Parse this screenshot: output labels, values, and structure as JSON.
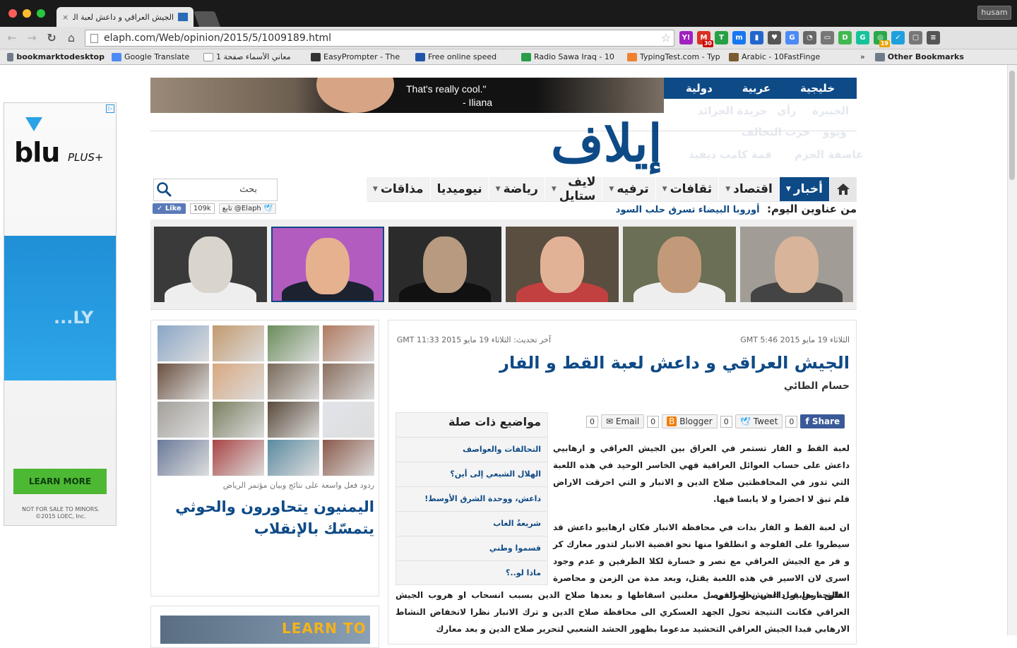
{
  "browser": {
    "tab_title": "الجيش العراقي و داعش لعبة القط و",
    "user_button": "husam",
    "url": "elaph.com/Web/opinion/2015/5/1009189.html",
    "extensions": [
      {
        "icon": "yahoo-icon",
        "label": "Y!",
        "color": "#a020c0"
      },
      {
        "icon": "gmail-icon",
        "label": "M",
        "color": "#d93025"
      },
      {
        "icon": "trello-icon",
        "label": "T",
        "color": "#26a046"
      },
      {
        "icon": "messenger-icon",
        "label": "m",
        "color": "#1877f2"
      },
      {
        "icon": "stats-icon",
        "label": "▮",
        "color": "#2266cc"
      },
      {
        "icon": "pocket-icon",
        "label": "♥",
        "color": "#555555"
      },
      {
        "icon": "translate-icon",
        "label": "G",
        "color": "#4c8bf5"
      },
      {
        "icon": "clock-icon",
        "label": "◔",
        "color": "#666666"
      },
      {
        "icon": "cast-icon",
        "label": "▭",
        "color": "#777777"
      },
      {
        "icon": "pushbullet-icon",
        "label": "D",
        "color": "#3fb950"
      },
      {
        "icon": "grammarly-icon",
        "label": "G",
        "color": "#15c39a"
      },
      {
        "icon": "timer-icon",
        "label": "◎",
        "color": "#2aa84a"
      },
      {
        "icon": "check-icon",
        "label": "✓",
        "color": "#1ea0dc"
      },
      {
        "icon": "screen-icon",
        "label": "▢",
        "color": "#777777"
      },
      {
        "icon": "menu-icon",
        "label": "≡",
        "color": "#555555"
      }
    ],
    "gmail_badge": "30",
    "timer_badge": "19",
    "bookmarks": [
      {
        "label": "bookmarktodesktop",
        "icon": "folder-icon"
      },
      {
        "label": "Google Translate",
        "icon": "translate-icon"
      },
      {
        "label": "1 معاني الأسماء صفحة",
        "icon": "page-icon"
      },
      {
        "label": "EasyPrompter - The",
        "icon": "ep-icon"
      },
      {
        "label": "Free online speed",
        "icon": "speed-icon"
      },
      {
        "label": "Radio Sawa Iraq - 10",
        "icon": "radio-icon"
      },
      {
        "label": "TypingTest.com - Typ",
        "icon": "typing-icon"
      },
      {
        "label": "Arabic - 10FastFinge",
        "icon": "fingers-icon"
      }
    ],
    "bookmarks_overflow": "»",
    "other_bookmarks": "Other Bookmarks"
  },
  "ad_left": {
    "brand": "blu",
    "brand_suffix": "PLUS+",
    "blur_text": "...LY",
    "cta": "LEARN MORE",
    "fine1": "NOT FOR SALE TO MINORS.",
    "fine2": "©2015 LOEC, Inc.",
    "adchoice": "▷"
  },
  "banner": {
    "quote_line1": "That's really cool.\"",
    "quote_line2": "- Iliana"
  },
  "site": {
    "logo": "إيلاف",
    "top_categories": [
      "خليجية",
      "عربية",
      "دولية"
    ],
    "faint_row1": [
      "الخبيرة",
      "رأي",
      "جريدة الجرائد"
    ],
    "faint_row2": [
      "ويوو",
      "حرب التحالف"
    ],
    "faint_row3": [
      "عاصفة الحزم",
      "قمة كامب ديفيد"
    ],
    "nav": [
      {
        "label": "أخبار",
        "caret": true,
        "active": true
      },
      {
        "label": "اقتصاد",
        "caret": true
      },
      {
        "label": "ثقافات",
        "caret": true
      },
      {
        "label": "ترفيه",
        "caret": true
      },
      {
        "label": "لايف ستايل",
        "caret": true
      },
      {
        "label": "رياضة",
        "caret": true
      },
      {
        "label": "نيوميديا",
        "caret": false
      },
      {
        "label": "مذاقات",
        "caret": true
      }
    ],
    "search_placeholder": "بحث",
    "headlines_label": "من عناوين اليوم:",
    "headline_text": "أوروبا البيضاء تسرق حلب السود",
    "fb_like": "Like",
    "fb_count": "109k",
    "twitter_follow": "تابع @Elaph"
  },
  "side": {
    "caption": "ردود فعل واسعة على نتائج وبيان مؤتمر الرياض",
    "title": "اليمنيون يتحاورون والحوثي يتمسّك بالإنقلاب",
    "ad_text": "LEARN TO"
  },
  "article": {
    "published": "الثلاثاء 19 مايو 2015 GMT 5:46",
    "updated": "آخر تحديث: الثلاثاء 19 مايو 2015 GMT 11:33",
    "title": "الجيش العراقي و داعش لعبة القط و الفار",
    "author": "حسام الطائي",
    "share": {
      "fb_label": "Share",
      "fb_count": "0",
      "tweet_label": "Tweet",
      "tweet_count": "0",
      "blogger_label": "Blogger",
      "blogger_count": "0",
      "email_label": "Email",
      "email_count": "0"
    },
    "related_title": "مواضيع ذات صلة",
    "related": [
      "التحالفات والعواصف",
      "الهلال الشيعي إلى أين؟",
      "داعش، ووحدة الشرق الأوسط!",
      "شريعةُ الغاب",
      "قسموا وطني",
      "ماذا لو..؟"
    ],
    "para1": "لعبة القط و الفار تستمر في العراق بين الجيش العراقي و ارهابيي داعش على حساب العوائل العراقية فهي الخاسر الوحيد في هذه اللعبة التي تدور في المحافظتين صلاح الدين و الانبار و التي احرقت الاراض فلم تبق لا اخضرا و لا يابسا فيها.",
    "para2": "ان لعبة القط و الفار بدات في محافظة الانبار فكان ارهابيو داعش قد سيطروا على الفلوجة و انطلقوا منها نحو اقضية الانبار لتدور معارك كر و فر مع الجيش العراقي مع نصر و خسارة لكلا الطرفين و عدم وجود اسرى لان الاسير في هذه اللعبة يقتل، وبعد مدة من الزمن و محاصرة الفلوجة من قبل الجيش العراقي",
    "para3": "انطلق ارهابيو داعش نحو الموصل معلنين اسقاطها و بعدها صلاح الدين بسبب انسحاب او هروب الجيش العراقي فكانت النتيجة تحول الجهد العسكري الى محافظة صلاح الدين و ترك الانبار نظرا لانخفاض النشاط الارهابي فبدا الجيش العراقي التحشيد مدعوما بظهور الحشد الشعبي لتحرير صلاح الدين و بعد معارك"
  }
}
